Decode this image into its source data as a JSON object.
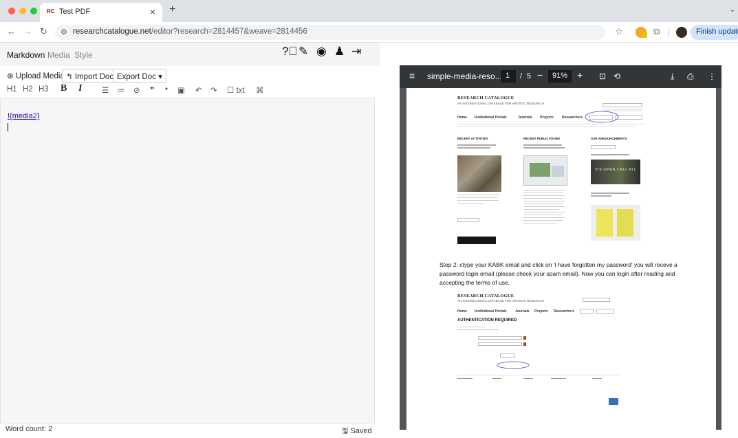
{
  "browser": {
    "tab_title": "Test PDF",
    "tab_favicon_text": "RC",
    "url_host": "researchcatalogue.net",
    "url_rest": "/editor?research=2814457&weave=2814456",
    "finish_update_label": "Finish update",
    "colors": {
      "close": "#ff5f57",
      "minimize": "#febc2e",
      "maximize": "#28c840"
    }
  },
  "editor": {
    "tabs": [
      "Markdown",
      "Media",
      "Style"
    ],
    "toolbar": {
      "upload_media": "Upload Media",
      "import_doc": "Import Doc",
      "export_doc": "Export Doc"
    },
    "format_buttons": {
      "h1": "H1",
      "h2": "H2",
      "h3": "H3",
      "bold": "B",
      "italic": "I",
      "txt": "txt"
    },
    "content_text": "!{media2}",
    "word_count": "Word count: 2",
    "status": "Saved"
  },
  "pdf_viewer": {
    "filename": "simple-media-reso...",
    "current_page": "1",
    "page_separator": "/",
    "total_pages": "5",
    "zoom": "91%",
    "page": {
      "site_title": "RESEARCH CATALOGUE",
      "site_subtitle": "AN INTERNATIONAL DATABASE FOR ARTISTIC RESEARCH",
      "nav": [
        "Home",
        "Institutional Portals",
        "Journals",
        "Projects",
        "Researchers"
      ],
      "sections": [
        "RECENT ACTIVITIES",
        "RECENT PUBLICATIONS",
        "SAR ANNOUNCEMENTS"
      ],
      "banner_text": "VIS OPEN CALL #11",
      "step2_text": "Step 2: ctype your KABK email and click on 'I have forgotten my password' you will receve a password login email (please check your spam email). Now you can login after reading and accepting the terms of use.",
      "auth_title": "AUTHENTICATION REQUIRED"
    }
  }
}
